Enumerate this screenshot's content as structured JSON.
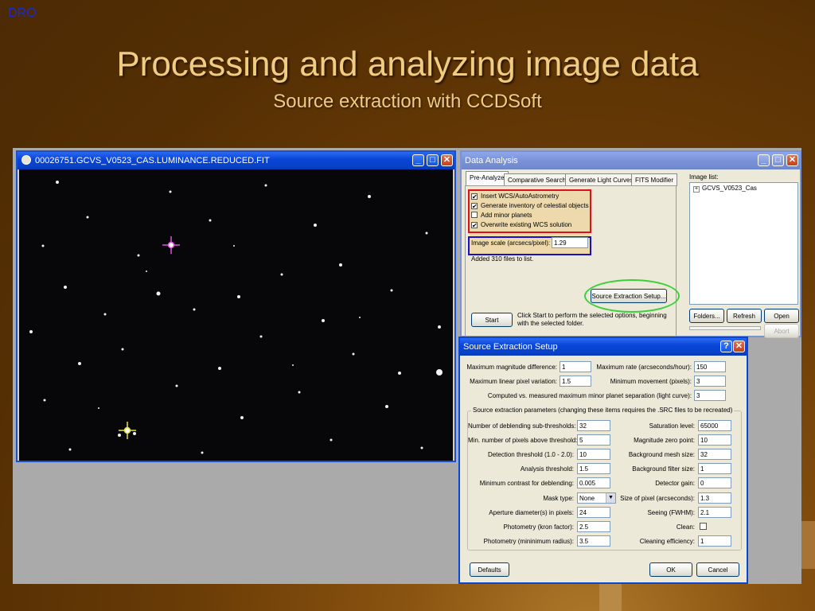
{
  "slide": {
    "tag": "DRO",
    "title": "Processing and analyzing image data",
    "subtitle": "Source extraction with CCDSoft"
  },
  "colors": {
    "background": "#6a3c06",
    "title_text": "#f0cc82",
    "tag_text": "#1a2ad8",
    "xp_titlebar": "#0a46d8",
    "highlight_red": "#e0101a",
    "highlight_blue": "#1810c8",
    "highlight_green": "#3ad03a"
  },
  "image_window": {
    "title": "00026751.GCVS_V0523_CAS.LUMINANCE.REDUCED.FIT",
    "icon": "fits-file-icon",
    "controls": [
      "minimize-icon",
      "maximize-icon",
      "close-icon"
    ]
  },
  "data_analysis": {
    "title": "Data Analysis",
    "tabs": [
      {
        "label": "Pre-Analyze"
      },
      {
        "label": "Comparative Search"
      },
      {
        "label": "Generate Light Curves"
      },
      {
        "label": "FITS Modifier"
      }
    ],
    "options": [
      {
        "label": "Insert WCS/AutoAstrometry",
        "checked": true,
        "mark": "✔"
      },
      {
        "label": "Generate inventory of celestial objects",
        "checked": true,
        "mark": "✔"
      },
      {
        "label": "Add minor planets",
        "checked": false,
        "mark": ""
      },
      {
        "label": "Overwrite existing WCS solution",
        "checked": true,
        "mark": "✔"
      }
    ],
    "image_scale_label": "Image scale (arcsecs/pixel):",
    "image_scale_value": "1.29",
    "status": "Added 310 files to list.",
    "source_extraction_button": "Source Extraction Setup...",
    "start_button": "Start",
    "start_hint_line1": "Click Start to perform the selected options, beginning",
    "start_hint_line2": "with the selected folder.",
    "image_list_label": "Image list:",
    "image_list_items": [
      {
        "expander": "+",
        "label": "GCVS_V0523_Cas"
      }
    ],
    "folders_button": "Folders...",
    "refresh_button": "Refresh",
    "open_button": "Open",
    "abort_button": "Abort"
  },
  "source_extraction": {
    "title": "Source Extraction Setup",
    "help_icon": "?",
    "top_fields": {
      "max_mag_diff": {
        "label": "Maximum magnitude difference:",
        "value": "1"
      },
      "max_rate": {
        "label": "Maximum rate (arcseconds/hour):",
        "value": "150"
      },
      "max_linear_var": {
        "label": "Maximum linear pixel variation:",
        "value": "1.5"
      },
      "min_movement": {
        "label": "Minimum movement (pixels):",
        "value": "3"
      },
      "min_planet_sep": {
        "label": "Computed vs. measured maximum minor planet separation (light curve):",
        "value": "3"
      }
    },
    "group_label": "Source extraction parameters (changing these items requires the .SRC files to be recreated)",
    "left_fields": [
      {
        "label": "Number of deblending sub-thresholds:",
        "value": "32"
      },
      {
        "label": "Min. number of pixels above threshold:",
        "value": "5"
      },
      {
        "label": "Detection threshold (1.0 - 2.0):",
        "value": "10"
      },
      {
        "label": "Analysis threshold:",
        "value": "1.5"
      },
      {
        "label": "Minimum contrast for deblending:",
        "value": "0.005"
      },
      {
        "label": "Mask type:",
        "value": "None"
      },
      {
        "label": "Aperture diameter(s) in pixels:",
        "value": "24"
      },
      {
        "label": "Photometry (kron factor):",
        "value": "2.5"
      },
      {
        "label": "Photometry (mininimum radius):",
        "value": "3.5"
      }
    ],
    "right_fields": [
      {
        "label": "Saturation level:",
        "value": "65000"
      },
      {
        "label": "Magnitude zero point:",
        "value": "10"
      },
      {
        "label": "Background mesh size:",
        "value": "32"
      },
      {
        "label": "Background filter size:",
        "value": "1"
      },
      {
        "label": "Detector gain:",
        "value": "0"
      },
      {
        "label": "Size of pixel (arcseconds):",
        "value": "1.3"
      },
      {
        "label": "Seeing (FWHM):",
        "value": "2.1"
      },
      {
        "label": "Clean:",
        "value": ""
      },
      {
        "label": "Cleaning efficiency:",
        "value": "1"
      }
    ],
    "defaults_button": "Defaults",
    "ok_button": "OK",
    "cancel_button": "Cancel"
  }
}
